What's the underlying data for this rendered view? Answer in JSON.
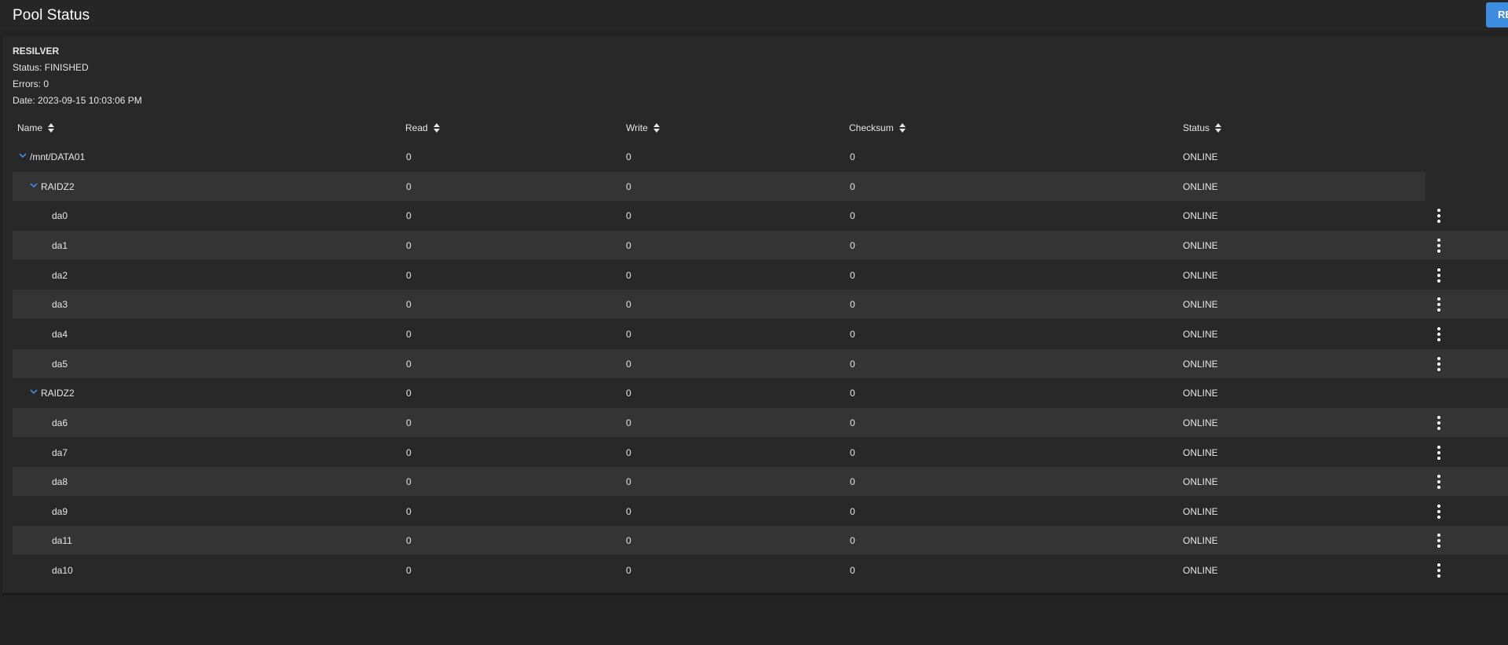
{
  "header": {
    "title": "Pool Status",
    "button_label": "RE"
  },
  "scan": {
    "title": "RESILVER",
    "status": "Status: FINISHED",
    "errors": "Errors: 0",
    "date": "Date: 2023-09-15 10:03:06 PM"
  },
  "table": {
    "columns": [
      "Name",
      "Read",
      "Write",
      "Checksum",
      "Status"
    ],
    "rows": [
      {
        "name": "/mnt/DATA01",
        "level": 0,
        "expandable": true,
        "read": "0",
        "write": "0",
        "checksum": "0",
        "status": "ONLINE",
        "menu": false
      },
      {
        "name": "RAIDZ2",
        "level": 1,
        "expandable": true,
        "read": "0",
        "write": "0",
        "checksum": "0",
        "status": "ONLINE",
        "menu": false
      },
      {
        "name": "da0",
        "level": 2,
        "expandable": false,
        "read": "0",
        "write": "0",
        "checksum": "0",
        "status": "ONLINE",
        "menu": true
      },
      {
        "name": "da1",
        "level": 2,
        "expandable": false,
        "read": "0",
        "write": "0",
        "checksum": "0",
        "status": "ONLINE",
        "menu": true
      },
      {
        "name": "da2",
        "level": 2,
        "expandable": false,
        "read": "0",
        "write": "0",
        "checksum": "0",
        "status": "ONLINE",
        "menu": true
      },
      {
        "name": "da3",
        "level": 2,
        "expandable": false,
        "read": "0",
        "write": "0",
        "checksum": "0",
        "status": "ONLINE",
        "menu": true
      },
      {
        "name": "da4",
        "level": 2,
        "expandable": false,
        "read": "0",
        "write": "0",
        "checksum": "0",
        "status": "ONLINE",
        "menu": true
      },
      {
        "name": "da5",
        "level": 2,
        "expandable": false,
        "read": "0",
        "write": "0",
        "checksum": "0",
        "status": "ONLINE",
        "menu": true
      },
      {
        "name": "RAIDZ2",
        "level": 1,
        "expandable": true,
        "read": "0",
        "write": "0",
        "checksum": "0",
        "status": "ONLINE",
        "menu": false
      },
      {
        "name": "da6",
        "level": 2,
        "expandable": false,
        "read": "0",
        "write": "0",
        "checksum": "0",
        "status": "ONLINE",
        "menu": true
      },
      {
        "name": "da7",
        "level": 2,
        "expandable": false,
        "read": "0",
        "write": "0",
        "checksum": "0",
        "status": "ONLINE",
        "menu": true
      },
      {
        "name": "da8",
        "level": 2,
        "expandable": false,
        "read": "0",
        "write": "0",
        "checksum": "0",
        "status": "ONLINE",
        "menu": true
      },
      {
        "name": "da9",
        "level": 2,
        "expandable": false,
        "read": "0",
        "write": "0",
        "checksum": "0",
        "status": "ONLINE",
        "menu": true
      },
      {
        "name": "da11",
        "level": 2,
        "expandable": false,
        "read": "0",
        "write": "0",
        "checksum": "0",
        "status": "ONLINE",
        "menu": true
      },
      {
        "name": "da10",
        "level": 2,
        "expandable": false,
        "read": "0",
        "write": "0",
        "checksum": "0",
        "status": "ONLINE",
        "menu": true
      }
    ]
  },
  "colors": {
    "accent": "#3d8ee0",
    "background": "#232323",
    "card": "#282828",
    "row_shaded": "#343434",
    "text": "#e6e6e6"
  }
}
